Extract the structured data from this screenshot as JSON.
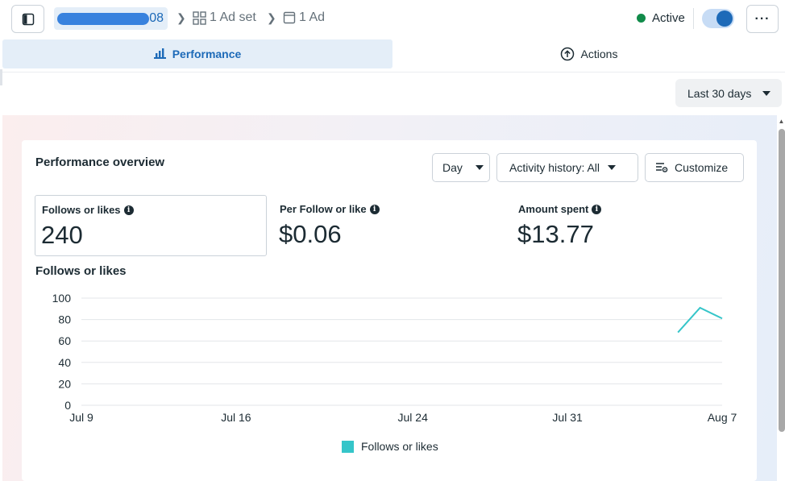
{
  "header": {
    "campaign_suffix": "08",
    "adset_label": "1 Ad set",
    "ad_label": "1 Ad",
    "status_label": "Active",
    "more_label": "···"
  },
  "tabs": [
    {
      "label": "Performance",
      "active": true
    },
    {
      "label": "Actions",
      "active": false
    }
  ],
  "date_range": "Last 30 days",
  "card": {
    "title": "Performance overview",
    "granularity": "Day",
    "activity_history": "Activity history: All",
    "customize_label": "Customize",
    "metrics": [
      {
        "label": "Follows or likes",
        "value": "240"
      },
      {
        "label": "Per Follow or like",
        "value": "$0.06"
      },
      {
        "label": "Amount spent",
        "value": "$13.77"
      }
    ],
    "chart_title": "Follows or likes"
  },
  "colors": {
    "accent": "#1d6ab8",
    "series": "#35c5c9",
    "active": "#118b4a"
  },
  "chart_data": {
    "type": "line",
    "title": "Follows or likes",
    "ylim": [
      0,
      100
    ],
    "yticks": [
      0,
      20,
      40,
      60,
      80,
      100
    ],
    "xticks": [
      "Jul 9",
      "Jul 16",
      "Jul 24",
      "Jul 31",
      "Aug 7"
    ],
    "xtick_days": [
      0,
      7,
      15,
      22,
      29
    ],
    "xlim_days": [
      0,
      29
    ],
    "grid": true,
    "legend": "bottom",
    "series": [
      {
        "name": "Follows or likes",
        "x_days": [
          27,
          28,
          29
        ],
        "values": [
          68,
          91,
          81
        ]
      }
    ]
  }
}
